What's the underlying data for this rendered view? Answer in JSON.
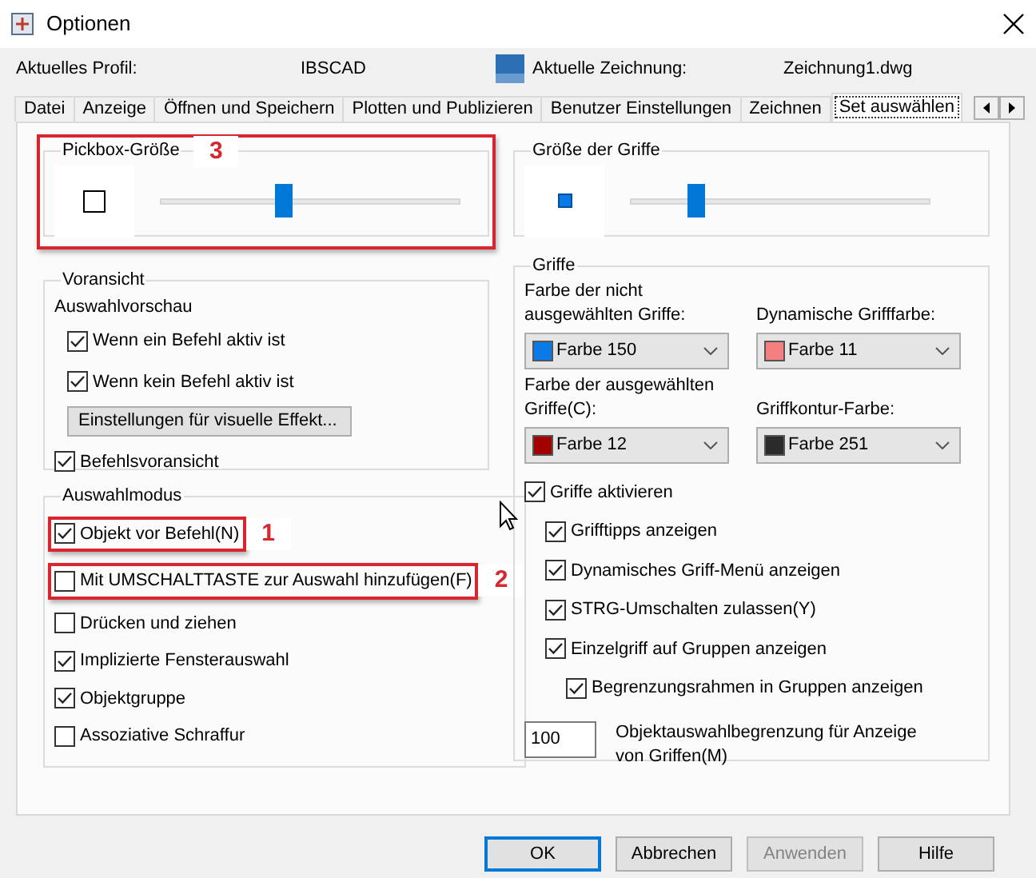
{
  "window": {
    "title": "Optionen"
  },
  "profile": {
    "label": "Aktuelles Profil:",
    "value": "IBSCAD",
    "drawing_label": "Aktuelle Zeichnung:",
    "drawing_value": "Zeichnung1.dwg"
  },
  "tabs": [
    {
      "label": "Datei",
      "selected": false
    },
    {
      "label": "Anzeige",
      "selected": false
    },
    {
      "label": "Öffnen und Speichern",
      "selected": false
    },
    {
      "label": "Plotten und Publizieren",
      "selected": false
    },
    {
      "label": "Benutzer Einstellungen",
      "selected": false
    },
    {
      "label": "Zeichnen",
      "selected": false
    },
    {
      "label": "Set auswählen",
      "selected": true
    }
  ],
  "pickbox": {
    "title": "Pickbox-Größe",
    "level": 0.41,
    "annotation": "3"
  },
  "grip_size": {
    "title": "Größe der Griffe",
    "level": 0.22
  },
  "preview": {
    "title": "Voransicht",
    "subtitle": "Auswahlvorschau",
    "options": [
      {
        "label": "Wenn ein Befehl aktiv ist",
        "checked": true
      },
      {
        "label": "Wenn kein Befehl aktiv ist",
        "checked": true
      }
    ],
    "button": "Einstellungen für visuelle Effekt...",
    "command_preview": {
      "label": "Befehlsvoransicht",
      "checked": true
    }
  },
  "selection_mode": {
    "title": "Auswahlmodus",
    "options": [
      {
        "label": "Objekt vor Befehl(N)",
        "checked": true,
        "annotation": "1"
      },
      {
        "label": "Mit UMSCHALTTASTE zur Auswahl hinzufügen(F)",
        "checked": false,
        "annotation": "2"
      },
      {
        "label": "Drücken und ziehen",
        "checked": false
      },
      {
        "label": "Implizierte Fensterauswahl",
        "checked": true
      },
      {
        "label": "Objektgruppe",
        "checked": true
      },
      {
        "label": "Assoziative Schraffur",
        "checked": false
      }
    ]
  },
  "grips": {
    "title": "Griffe",
    "colors": [
      {
        "label": "Farbe der nicht ausgewählten Griffe:",
        "value": "Farbe 150",
        "color": "#0a7ae6"
      },
      {
        "label": "Dynamische Grifffarbe:",
        "value": "Farbe 11",
        "color": "#f28080"
      },
      {
        "label": "Farbe der ausgewählten Griffe(C):",
        "value": "Farbe 12",
        "color": "#a30000"
      },
      {
        "label": "Griffkontur-Farbe:",
        "value": "Farbe 251",
        "color": "#2b2b2b"
      }
    ],
    "options": [
      {
        "label": "Griffe aktivieren",
        "checked": true,
        "children": [
          {
            "label": "Grifftipps anzeigen",
            "checked": true
          },
          {
            "label": "Dynamisches Griff-Menü anzeigen",
            "checked": true
          },
          {
            "label": "STRG-Umschalten zulassen(Y)",
            "checked": true
          },
          {
            "label": "Einzelgriff auf Gruppen anzeigen",
            "checked": true,
            "children": [
              {
                "label": "Begrenzungsrahmen in Gruppen anzeigen",
                "checked": true
              }
            ]
          }
        ]
      }
    ],
    "limit": {
      "value": "100",
      "label": "Objektauswahlbegrenzung für Anzeige von Griffen(M)"
    }
  },
  "buttons": [
    {
      "label": "OK",
      "kind": "default",
      "disabled": false
    },
    {
      "label": "Abbrechen",
      "kind": "normal",
      "disabled": false
    },
    {
      "label": "Anwenden",
      "kind": "normal",
      "disabled": true
    },
    {
      "label": "Hilfe",
      "kind": "normal",
      "disabled": false
    }
  ]
}
